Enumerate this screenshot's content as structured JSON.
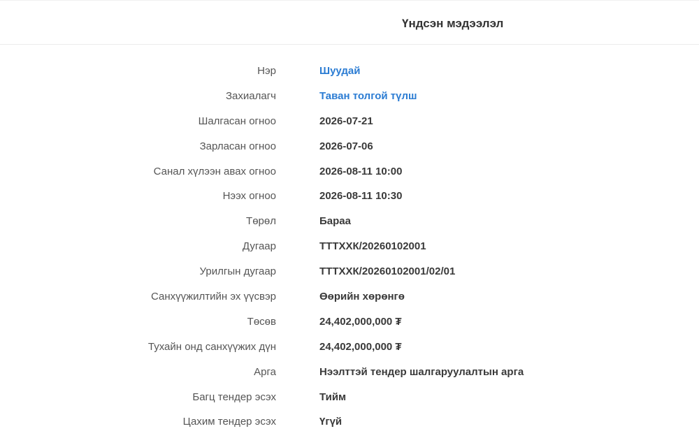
{
  "section": {
    "title": "Үндсэн мэдээлэл"
  },
  "accent_color": "#2b7cd3",
  "details": [
    {
      "label": "Нэр",
      "value": "Шуудай",
      "link": true
    },
    {
      "label": "Захиалагч",
      "value": "Таван толгой түлш",
      "link": true
    },
    {
      "label": "Шалгасан огноо",
      "value": "2026-07-21",
      "link": false
    },
    {
      "label": "Зарласан огноо",
      "value": "2026-07-06",
      "link": false
    },
    {
      "label": "Санал хүлээн авах огноо",
      "value": "2026-08-11 10:00",
      "link": false
    },
    {
      "label": "Нээх огноо",
      "value": "2026-08-11 10:30",
      "link": false
    },
    {
      "label": "Төрөл",
      "value": "Бараа",
      "link": false
    },
    {
      "label": "Дугаар",
      "value": "ТТТХХК/20260102001",
      "link": false
    },
    {
      "label": "Урилгын дугаар",
      "value": "ТТТХХК/20260102001/02/01",
      "link": false
    },
    {
      "label": "Санхүүжилтийн эх үүсвэр",
      "value": "Өөрийн хөрөнгө",
      "link": false
    },
    {
      "label": "Төсөв",
      "value": "24,402,000,000 ₮",
      "link": false
    },
    {
      "label": "Тухайн онд санхүүжих дүн",
      "value": "24,402,000,000 ₮",
      "link": false
    },
    {
      "label": "Арга",
      "value": "Нээлттэй тендер шалгаруулалтын арга",
      "link": false
    },
    {
      "label": "Багц тендер эсэх",
      "value": "Тийм",
      "link": false
    },
    {
      "label": "Цахим тендер эсэх",
      "value": "Үгүй",
      "link": false
    }
  ]
}
